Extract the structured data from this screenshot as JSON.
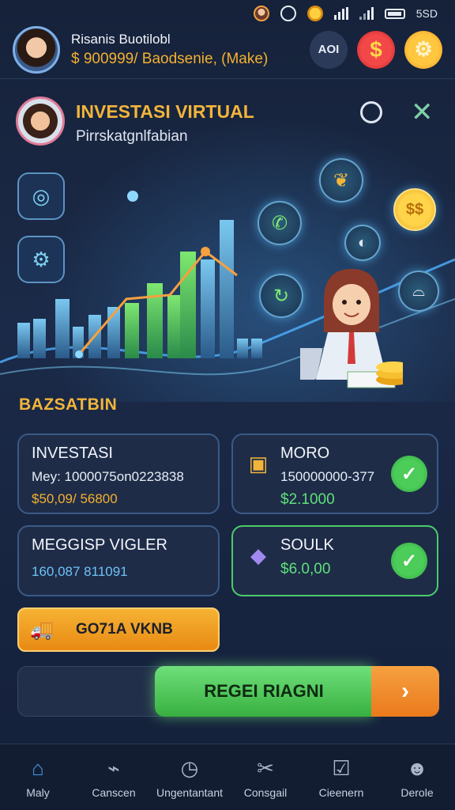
{
  "status_bar": {
    "network_label": "5SD",
    "icons": [
      "avatar-icon",
      "alarm-icon",
      "coin-icon",
      "signal-icon",
      "wifi-icon",
      "battery-icon"
    ]
  },
  "header": {
    "user_name": "Risanis Buotilobl",
    "user_balance": "$ 900999/ Baodsenie, (Make)",
    "button_aoi": "AOI",
    "button_dollar": "$",
    "button_gear": "⚙"
  },
  "hero": {
    "title": "INVESTASI VIRTUAL",
    "subtitle": "Pirrskatgnlfabian"
  },
  "section": {
    "title": "BAZSATBIN"
  },
  "cards": [
    {
      "title": "INVESTASI",
      "line": "Mey: 1000075on0223838",
      "amount": "$50,09/ 56800"
    },
    {
      "title": "MORO",
      "line": "150000000-377",
      "amount": "$2.1000"
    },
    {
      "title": "MEGGISP VIGLER",
      "line": "160,087 811091"
    },
    {
      "title": "SOULK",
      "amount": "$6.0,00"
    }
  ],
  "actions": {
    "orange_button": "GO71A VKNB",
    "register_button": "REGEI RIAGNI",
    "register_arrow": "›"
  },
  "bottom_nav": [
    {
      "label": "Maly",
      "icon": "home-icon",
      "active": true
    },
    {
      "label": "Canscen",
      "icon": "chart-icon",
      "active": false
    },
    {
      "label": "Ungentantant",
      "icon": "clock-icon",
      "active": false
    },
    {
      "label": "Consgail",
      "icon": "tools-icon",
      "active": false
    },
    {
      "label": "Cieenern",
      "icon": "checklist-icon",
      "active": false
    },
    {
      "label": "Derole",
      "icon": "profile-icon",
      "active": false
    }
  ],
  "colors": {
    "accent_gold": "#f2b53a",
    "accent_green": "#4ccc58",
    "accent_blue": "#3f9aeb",
    "background": "#16223a"
  }
}
